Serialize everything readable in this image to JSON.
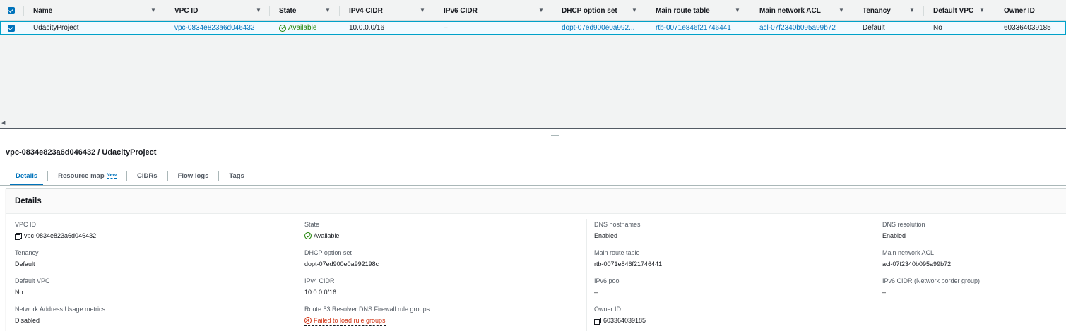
{
  "table": {
    "columns": [
      "Name",
      "VPC ID",
      "State",
      "IPv4 CIDR",
      "IPv6 CIDR",
      "DHCP option set",
      "Main route table",
      "Main network ACL",
      "Tenancy",
      "Default VPC",
      "Owner ID"
    ],
    "row": {
      "name": "UdacityProject",
      "vpc_id": "vpc-0834e823a6d046432",
      "state": "Available",
      "ipv4_cidr": "10.0.0.0/16",
      "ipv6_cidr": "–",
      "dhcp_option_set": "dopt-07ed900e0a992...",
      "main_route_table": "rtb-0071e846f21746441",
      "main_network_acl": "acl-07f2340b095a99b72",
      "tenancy": "Default",
      "default_vpc": "No",
      "owner_id": "603364039185"
    }
  },
  "detail": {
    "title": "vpc-0834e823a6d046432 / UdacityProject",
    "tabs": [
      "Details",
      "Resource map",
      "CIDRs",
      "Flow logs",
      "Tags"
    ],
    "new_badge": "New",
    "card_title": "Details",
    "fields": {
      "vpc_id": {
        "label": "VPC ID",
        "value": "vpc-0834e823a6d046432"
      },
      "state": {
        "label": "State",
        "value": "Available"
      },
      "dns_hostnames": {
        "label": "DNS hostnames",
        "value": "Enabled"
      },
      "dns_resolution": {
        "label": "DNS resolution",
        "value": "Enabled"
      },
      "tenancy": {
        "label": "Tenancy",
        "value": "Default"
      },
      "dhcp_option_set": {
        "label": "DHCP option set",
        "value": "dopt-07ed900e0a992198c"
      },
      "main_route_table": {
        "label": "Main route table",
        "value": "rtb-0071e846f21746441"
      },
      "main_network_acl": {
        "label": "Main network ACL",
        "value": "acl-07f2340b095a99b72"
      },
      "default_vpc": {
        "label": "Default VPC",
        "value": "No"
      },
      "ipv4_cidr": {
        "label": "IPv4 CIDR",
        "value": "10.0.0.0/16"
      },
      "ipv6_pool": {
        "label": "IPv6 pool",
        "value": "–"
      },
      "ipv6_cidr_nbg": {
        "label": "IPv6 CIDR (Network border group)",
        "value": "–"
      },
      "nau_metrics": {
        "label": "Network Address Usage metrics",
        "value": "Disabled"
      },
      "route53_firewall": {
        "label": "Route 53 Resolver DNS Firewall rule groups",
        "value": "Failed to load rule groups"
      },
      "owner_id": {
        "label": "Owner ID",
        "value": "603364039185"
      }
    }
  },
  "colors": {
    "link": "#0073bb",
    "success": "#1d8102",
    "error": "#d13212",
    "selected_row_bg": "#f1faff",
    "selected_row_border": "#00a1c9"
  }
}
